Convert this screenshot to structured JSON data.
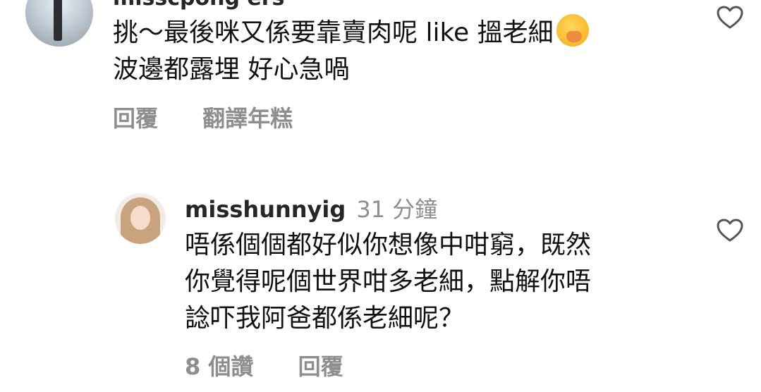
{
  "top_comment": {
    "username": "misscpong ers",
    "text_line1": "挑～最後咪又係要靠賣肉呢 like 搵老細",
    "text_line2": "波邊都露埋 好心急喎",
    "emoji": "hand-over-mouth-emoji",
    "reply_label": "回覆",
    "translate_label": "翻譯年糕",
    "like_icon": "heart-icon"
  },
  "reply_comment": {
    "username": "misshunnyig",
    "time": "31 分鐘",
    "text_line1": "唔係個個都好似你想像中咁窮，既然",
    "text_line2": "你覺得呢個世界咁多老細，點解你唔",
    "text_line3": "諗吓我阿爸都係老細呢？",
    "likes_label": "8 個讚",
    "reply_label": "回覆",
    "like_icon": "heart-icon"
  }
}
